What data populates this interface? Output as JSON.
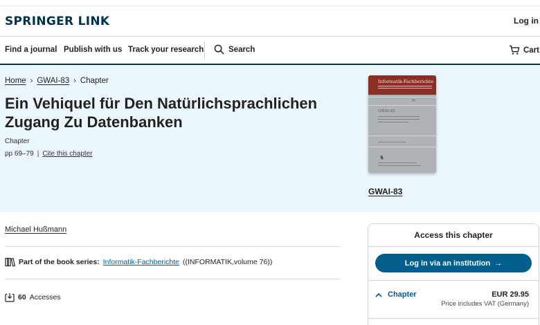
{
  "header": {
    "logo": "SPRINGER LINK",
    "login": "Log in"
  },
  "nav": {
    "find_journal": "Find a journal",
    "publish": "Publish with us",
    "track": "Track your research",
    "search": "Search",
    "cart": "Cart"
  },
  "breadcrumb": {
    "home": "Home",
    "book": "GWAI-83",
    "current": "Chapter"
  },
  "chapter": {
    "title": "Ein Vehiquel für Den Natürlichsprachlichen Zugang Zu Datenbanken",
    "type": "Chapter",
    "pages": "pp 69–79",
    "separator": "|",
    "cite": "Cite this chapter"
  },
  "book": {
    "cover_series": "Informatik-Fachberichte",
    "cover_volume": "76",
    "cover_name": "GWAI-83",
    "link": "GWAI-83"
  },
  "author": "Michael Hußmann",
  "series": {
    "label": "Part of the book series:",
    "link": "Informatik-Fachberichte",
    "suffix": "((INFORMATIK,volume 76))"
  },
  "accesses": {
    "count": "60",
    "label": "Accesses"
  },
  "access_box": {
    "title": "Access this chapter",
    "login_button": "Log in via an institution",
    "item_label": "Chapter",
    "price": "EUR 29.95",
    "vat_note": "Price includes VAT (Germany)"
  },
  "colors": {
    "brand": "#01324b",
    "link": "#025e8d",
    "hero_bg": "#eaf6fb",
    "cover_band": "#8a2f25"
  }
}
